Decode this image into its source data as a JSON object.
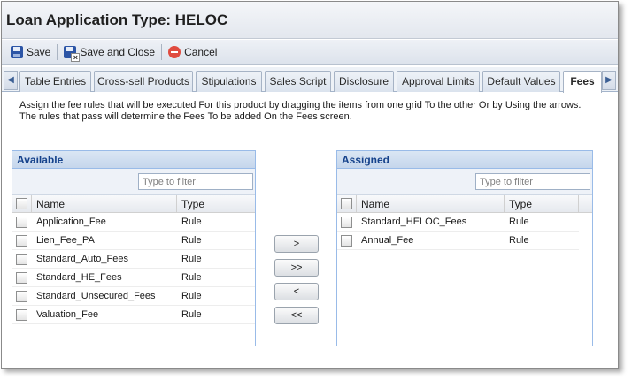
{
  "window": {
    "title": "Loan Application Type: HELOC"
  },
  "toolbar": {
    "save_label": "Save",
    "save_close_label": "Save and Close",
    "cancel_label": "Cancel"
  },
  "tabs": [
    {
      "label": "Table Entries"
    },
    {
      "label": "Cross-sell Products"
    },
    {
      "label": "Stipulations"
    },
    {
      "label": "Sales Script"
    },
    {
      "label": "Disclosure"
    },
    {
      "label": "Approval Limits"
    },
    {
      "label": "Default Values"
    },
    {
      "label": "Fees",
      "active": true
    }
  ],
  "instructions": {
    "line1": "Assign the fee rules that will be executed For this product by dragging the items from one grid To the other Or by Using the arrows.",
    "line2": "The rules that pass will determine the Fees To be added On the Fees screen."
  },
  "available": {
    "title": "Available",
    "filter_placeholder": "Type to filter",
    "columns": {
      "name": "Name",
      "type": "Type"
    },
    "rows": [
      {
        "name": "Application_Fee",
        "type": "Rule"
      },
      {
        "name": "Lien_Fee_PA",
        "type": "Rule"
      },
      {
        "name": "Standard_Auto_Fees",
        "type": "Rule"
      },
      {
        "name": "Standard_HE_Fees",
        "type": "Rule"
      },
      {
        "name": "Standard_Unsecured_Fees",
        "type": "Rule"
      },
      {
        "name": "Valuation_Fee",
        "type": "Rule"
      }
    ]
  },
  "assigned": {
    "title": "Assigned",
    "filter_placeholder": "Type to filter",
    "columns": {
      "name": "Name",
      "type": "Type"
    },
    "rows": [
      {
        "name": "Standard_HELOC_Fees",
        "type": "Rule"
      },
      {
        "name": "Annual_Fee",
        "type": "Rule"
      }
    ]
  },
  "move_buttons": {
    "move_right": ">",
    "move_all_right": ">>",
    "move_left": "<",
    "move_all_left": "<<"
  },
  "colors": {
    "panel_header_text": "#15428b",
    "panel_border": "#99bbe8",
    "cancel_icon": "#e04b3f",
    "save_icon": "#2c55a6"
  }
}
